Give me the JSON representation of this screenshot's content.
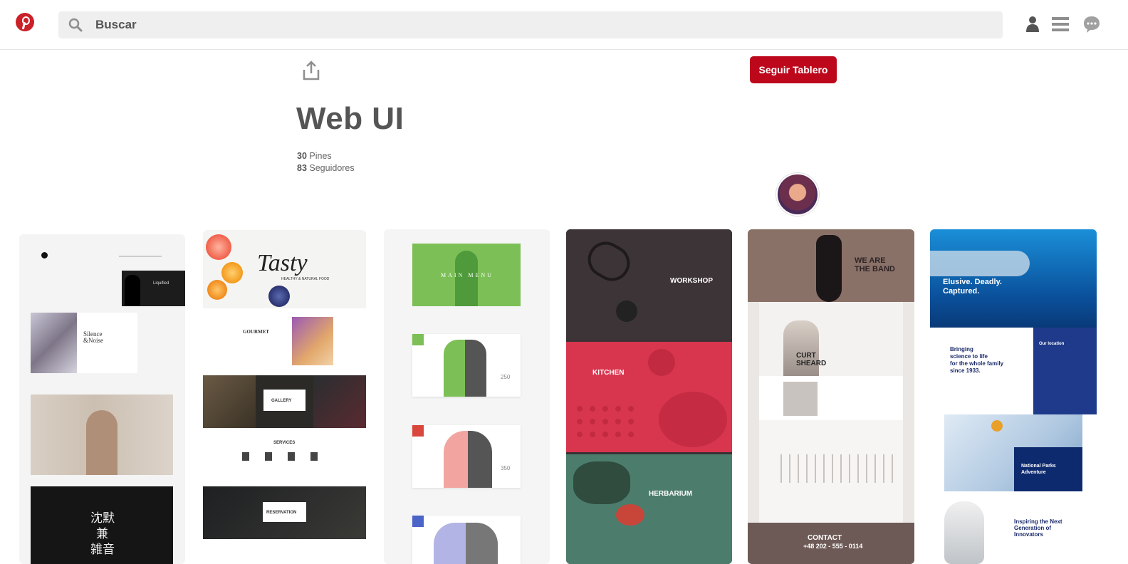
{
  "header": {
    "search_placeholder": "Buscar",
    "icons": [
      "pinterest-logo",
      "search-icon",
      "profile-icon",
      "menu-icon",
      "messages-icon"
    ]
  },
  "board": {
    "title": "Web UI",
    "follow_button": "Seguir Tablero",
    "pins_count": "30",
    "pins_label": "Pines",
    "followers_count": "83",
    "followers_label": "Seguidores"
  },
  "pins": {
    "pin1": {
      "title1": "Silence\n&Noise",
      "kanji1": "沈默",
      "kanji2": "兼",
      "kanji3": "雑音",
      "label": "Liquified"
    },
    "pin2": {
      "brand": "Tasty",
      "tagline": "HEALTHY & NATURAL FOOD",
      "gourmet": "GOURMET",
      "gallery": "GALLERY",
      "services": "SERVICES",
      "reservation": "RESERVATION"
    },
    "pin3": {
      "menu": "MAIN MENU",
      "n1": "250",
      "n2": "350"
    },
    "pin4": {
      "workshop": "WORKSHOP",
      "kitchen": "KITCHEN",
      "herbarium": "HERBARIUM"
    },
    "pin5": {
      "band": "WE ARE\nTHE BAND",
      "artist": "CURT\nSHEARD",
      "contact": "CONTACT",
      "phone": "+48 202 - 555 - 0114"
    },
    "pin6": {
      "hero": "Elusive. Deadly.\nCaptured.",
      "science": "Bringing\nscience to life\nfor the whole family\nsince 1933.",
      "location": "Our location",
      "parks": "National Parks\nAdventure",
      "robot": "Inspiring the Next\nGeneration of\nInnovators"
    }
  },
  "colors": {
    "brand_red": "#bd081c",
    "search_bg": "#efefef",
    "text_gray": "#555555"
  }
}
